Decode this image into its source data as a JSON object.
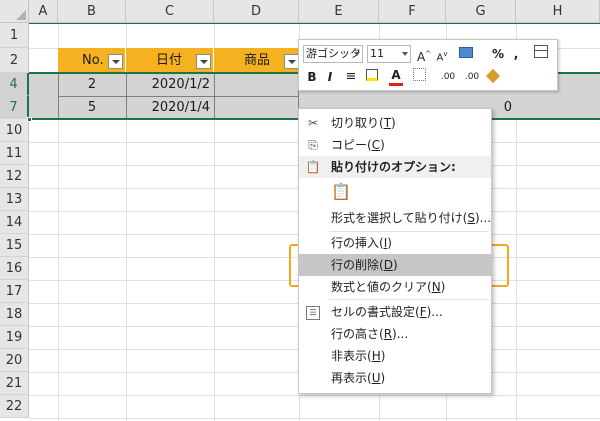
{
  "columns": [
    "A",
    "B",
    "C",
    "D",
    "E",
    "F",
    "G",
    "H"
  ],
  "rows": [
    "1",
    "2",
    "4",
    "7",
    "10",
    "11",
    "12",
    "13",
    "14",
    "15",
    "16",
    "17",
    "18",
    "19",
    "20",
    "21",
    "22"
  ],
  "table": {
    "headers": [
      "No.",
      "日付",
      "商品"
    ],
    "row4": {
      "no": "2",
      "date": "2020/1/2"
    },
    "row7": {
      "no": "5",
      "date": "2020/1/4",
      "g": "0"
    }
  },
  "mini_toolbar": {
    "font": "游ゴシック",
    "size": "11",
    "grow": "A",
    "shrink": "A",
    "percent": "%",
    "comma": ",",
    "bold": "B",
    "italic": "I",
    "font_color": "A",
    "dec_inc": ".00",
    "dec_dec": ".00"
  },
  "context_menu": {
    "cut": {
      "label": "切り取り(",
      "key": "T",
      "end": ")"
    },
    "copy": {
      "label": "コピー(",
      "key": "C",
      "end": ")"
    },
    "paste_options": "貼り付けのオプション:",
    "paste_special": {
      "label": "形式を選択して貼り付け(",
      "key": "S",
      "end": ")..."
    },
    "insert_row": {
      "label": "行の挿入(",
      "key": "I",
      "end": ")"
    },
    "delete_row": {
      "label": "行の削除(",
      "key": "D",
      "end": ")"
    },
    "clear_contents": {
      "label": "数式と値のクリア(",
      "key": "N",
      "end": ")"
    },
    "format_cells": {
      "label": "セルの書式設定(",
      "key": "F",
      "end": ")..."
    },
    "row_height": {
      "label": "行の高さ(",
      "key": "R",
      "end": ")..."
    },
    "hide": {
      "label": "非表示(",
      "key": "H",
      "end": ")"
    },
    "unhide": {
      "label": "再表示(",
      "key": "U",
      "end": ")"
    }
  },
  "colors": {
    "header_orange": "#f5b120",
    "selection_gray": "#d4d4d4",
    "excel_green": "#217346",
    "highlight_box": "#f5a623"
  }
}
